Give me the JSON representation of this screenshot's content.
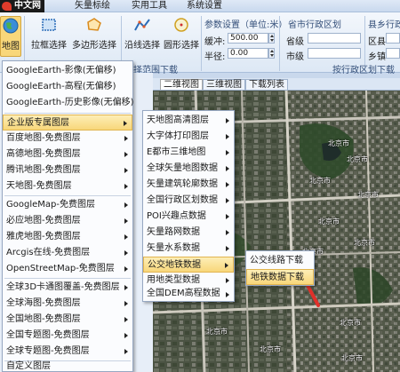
{
  "watermark": "中文网",
  "menubar": {
    "items": [
      "矢量标绘",
      "实用工具",
      "系统设置"
    ]
  },
  "ribbon": {
    "buttons": {
      "map": "地图",
      "rect_select": "拉框选择",
      "polygon_select": "多边形选择",
      "polyline_select": "沿线选择",
      "circle_select": "圆形选择"
    },
    "group_select": "选择范围下载",
    "param": {
      "title": "参数设置（单位:米）",
      "buffer_label": "缓冲:",
      "buffer_value": "500.00",
      "radius_label": "半径:",
      "radius_value": "0.00"
    },
    "district": {
      "title": "省市行政区划",
      "province_label": "省级",
      "city_label": "市级",
      "county_title": "县乡行政区",
      "county_label": "区县",
      "town_label": "乡镇",
      "group_label": "按行政区划下载"
    }
  },
  "view_tabs": [
    "二维视图",
    "三维视图",
    "下载列表"
  ],
  "primary_menu": {
    "items": [
      {
        "label": "GoogleEarth-影像(无偏移)"
      },
      {
        "label": "GoogleEarth-高程(无偏移)"
      },
      {
        "label": "GoogleEarth-历史影像(无偏移)"
      },
      {
        "label": "企业版专属图层"
      },
      {
        "label": "百度地图-免费图层"
      },
      {
        "label": "高德地图-免费图层"
      },
      {
        "label": "腾讯地图-免费图层"
      },
      {
        "label": "天地图-免费图层"
      },
      {
        "label": "GoogleMap-免费图层"
      },
      {
        "label": "必应地图-免费图层"
      },
      {
        "label": "雅虎地图-免费图层"
      },
      {
        "label": "Arcgis在线-免费图层"
      },
      {
        "label": "OpenStreetMap-免费图层"
      },
      {
        "label": "全球3D卡通图覆盖-免费图层"
      },
      {
        "label": "全球海图-免费图层"
      },
      {
        "label": "全国地图-免费图层"
      },
      {
        "label": "全国专题图-免费图层"
      },
      {
        "label": "全球专题图-免费图层"
      },
      {
        "label": "自定义图层"
      }
    ]
  },
  "sub_menu": {
    "items": [
      {
        "label": "天地图高清图层"
      },
      {
        "label": "大字体打印图层"
      },
      {
        "label": "E都市三维地图"
      },
      {
        "label": "全球矢量地图数据"
      },
      {
        "label": "矢量建筑轮廓数据"
      },
      {
        "label": "全国行政区划数据"
      },
      {
        "label": "POI兴趣点数据"
      },
      {
        "label": "矢量路网数据"
      },
      {
        "label": "矢量水系数据"
      },
      {
        "label": "公交地铁数据"
      },
      {
        "label": "用地类型数据"
      },
      {
        "label": "全国DEM高程数据"
      }
    ]
  },
  "third_menu": {
    "items": [
      {
        "label": "公交线路下载"
      },
      {
        "label": "地铁数据下载"
      }
    ]
  },
  "map": {
    "labels": [
      "北京市",
      "北京市",
      "北京市",
      "北京市",
      "北京市",
      "北京市",
      "北京市",
      "北京市",
      "北京市",
      "北京市",
      "北京市"
    ]
  },
  "colors": {
    "highlight": "#f8d77a",
    "ribbon_bg": "#dde8f5",
    "route_red": "#e0302a"
  }
}
